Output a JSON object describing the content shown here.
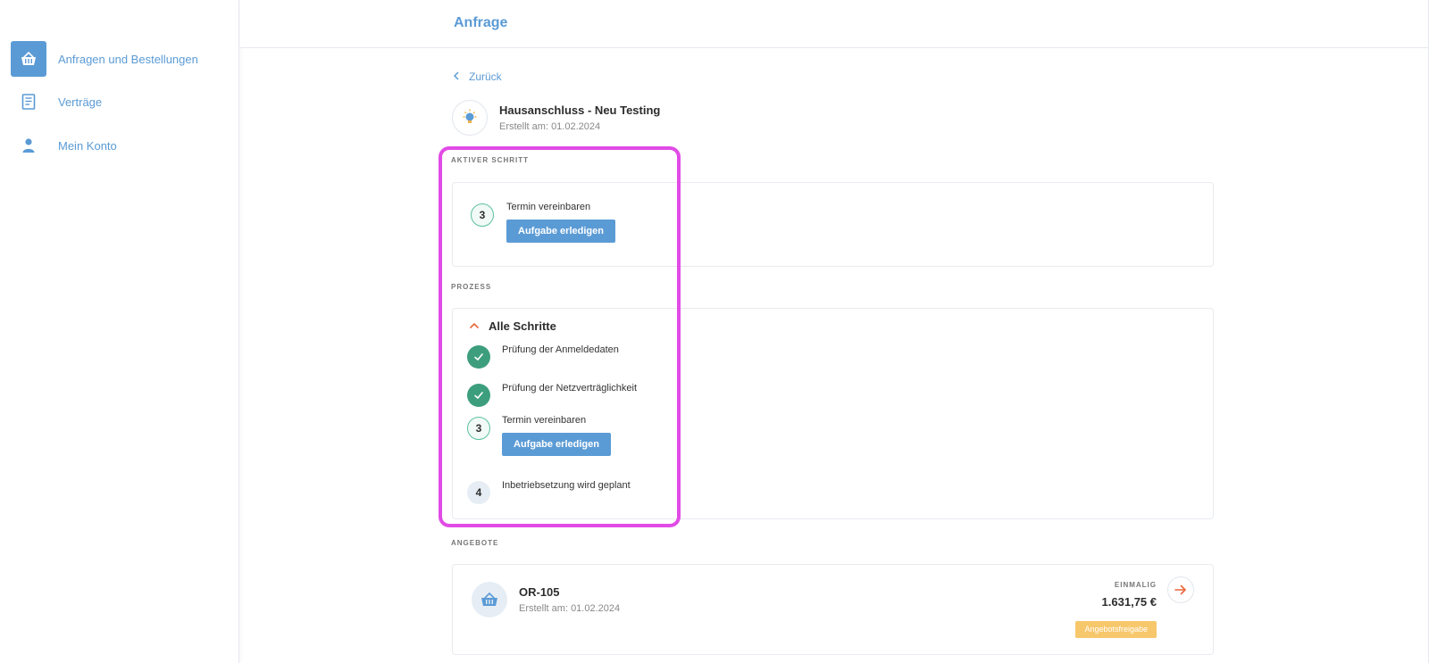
{
  "sidebar": {
    "items": [
      {
        "label": "Anfragen und Bestellungen",
        "icon": "basket-icon",
        "active": true
      },
      {
        "label": "Verträge",
        "icon": "document-icon",
        "active": false
      },
      {
        "label": "Mein Konto",
        "icon": "user-icon",
        "active": false
      }
    ]
  },
  "header": {
    "title": "Anfrage"
  },
  "back": {
    "label": "Zurück"
  },
  "request": {
    "title": "Hausanschluss - Neu Testing",
    "created": "Erstellt am: 01.02.2024",
    "icon": "lightbulb-icon"
  },
  "active_step": {
    "section_label": "AKTIVER SCHRITT",
    "number": "3",
    "label": "Termin vereinbaren",
    "button_label": "Aufgabe erledigen"
  },
  "process": {
    "section_label": "PROZESS",
    "toggle_label": "Alle Schritte",
    "steps": [
      {
        "number": "",
        "label": "Prüfung der Anmeldedaten",
        "state": "done"
      },
      {
        "number": "",
        "label": "Prüfung der Netzverträglichkeit",
        "state": "done"
      },
      {
        "number": "3",
        "label": "Termin vereinbaren",
        "state": "current",
        "button_label": "Aufgabe erledigen"
      },
      {
        "number": "4",
        "label": "Inbetriebsetzung wird geplant",
        "state": "pending"
      }
    ]
  },
  "offers": {
    "section_label": "ANGEBOTE",
    "items": [
      {
        "id": "OR-105",
        "created": "Erstellt am: 01.02.2024",
        "type": "EINMALIG",
        "price": "1.631,75 €",
        "badge": "Angebotsfreigabe"
      }
    ]
  },
  "colors": {
    "accent": "#5b9bd5",
    "done": "#3d9e7d",
    "current_border": "#5cc19e",
    "highlight": "#e14be6",
    "badge": "#f7c76b",
    "arrow": "#e8663a"
  }
}
